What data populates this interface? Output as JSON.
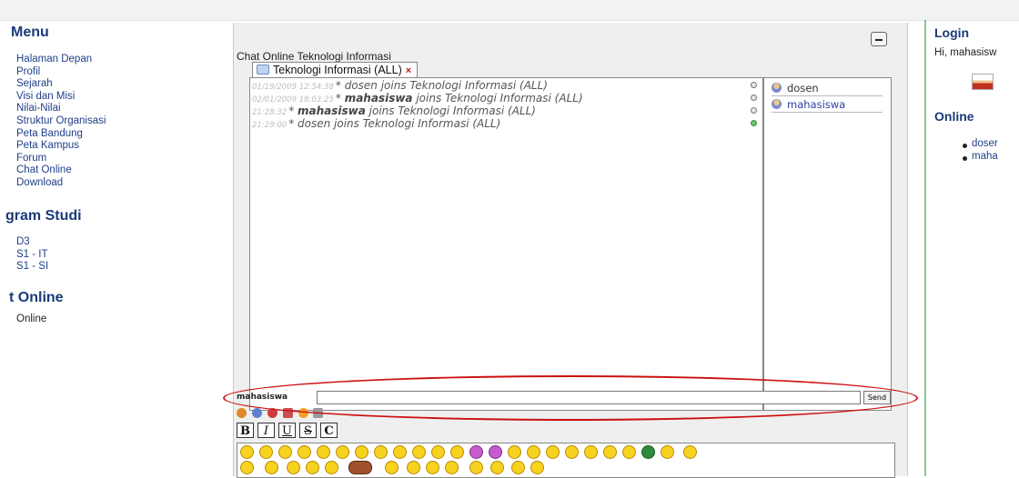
{
  "left": {
    "menu": {
      "heading": "Menu",
      "items": [
        "Halaman Depan",
        "Profil",
        "Sejarah",
        "Visi dan Misi",
        "Nilai-Nilai",
        "Struktur Organisasi",
        "Peta Bandung",
        "Peta Kampus",
        "Forum",
        "Chat Online",
        "Download"
      ]
    },
    "program": {
      "heading": "gram Studi",
      "items": [
        "D3",
        "S1 - IT",
        "S1 - SI"
      ]
    },
    "online": {
      "heading": "t Online",
      "text": "Online"
    }
  },
  "chat": {
    "title": "Chat Online Teknologi Informasi",
    "tab": {
      "label": "Teknologi Informasi (ALL)",
      "close": "×"
    },
    "messages": [
      {
        "time": "01/19/2009 12:54:38",
        "text": "* dosen joins Teknologi Informasi (ALL)",
        "user": "",
        "rest": "",
        "status": "gray"
      },
      {
        "time": "02/01/2009 18:03:25",
        "text": "* ",
        "user": "mahasiswa",
        "rest": " joins Teknologi Informasi (ALL)",
        "status": "gray"
      },
      {
        "time": "21:28:32",
        "text": "* ",
        "user": "mahasiswa",
        "rest": " joins Teknologi Informasi (ALL)",
        "status": "gray"
      },
      {
        "time": "21:29:00",
        "text": "* dosen joins Teknologi Informasi (ALL)",
        "user": "",
        "rest": "",
        "status": "green"
      }
    ],
    "users": [
      "dosen",
      "mahasiswa"
    ],
    "nickname": "mahasiswa",
    "input_value": "",
    "send_label": "Send",
    "format_buttons": [
      "B",
      "I",
      "U",
      "S",
      "C"
    ]
  },
  "right": {
    "login": {
      "heading": "Login",
      "greeting": "Hi, mahasisw"
    },
    "online": {
      "heading": "Online",
      "users": [
        "doser",
        "maha"
      ]
    }
  },
  "colors": {
    "accent": "#1a3a7a",
    "link": "#1f3f88",
    "highlight": "#cc1010",
    "divider": "#8dc58d"
  }
}
